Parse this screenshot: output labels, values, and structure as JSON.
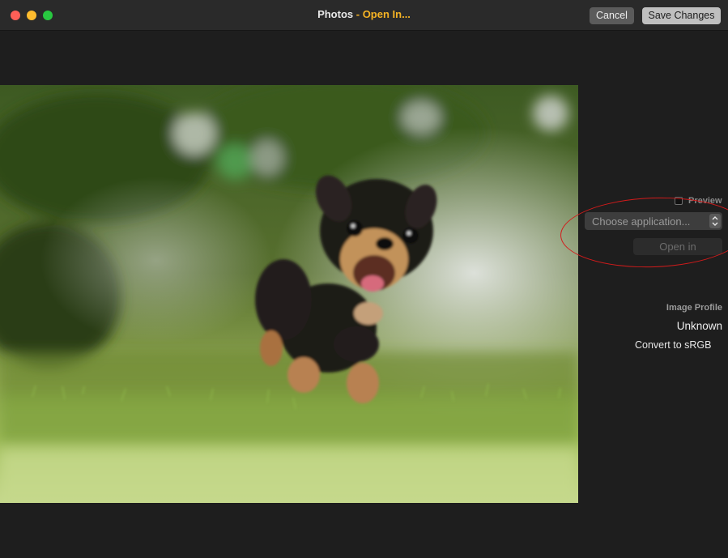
{
  "window": {
    "title_app": "Photos",
    "title_separator": " - ",
    "title_action": "Open In...",
    "cancel_label": "Cancel",
    "save_label": "Save Changes",
    "accent_color": "#f5b324"
  },
  "panel": {
    "preview_label": "Preview",
    "preview_checked": false,
    "app_select_placeholder": "Choose application...",
    "open_in_label": "Open in",
    "image_profile_label": "Image Profile",
    "image_profile_value": "Unknown",
    "convert_label": "Convert to sRGB"
  },
  "annotation": {
    "color": "#d31b1b"
  }
}
